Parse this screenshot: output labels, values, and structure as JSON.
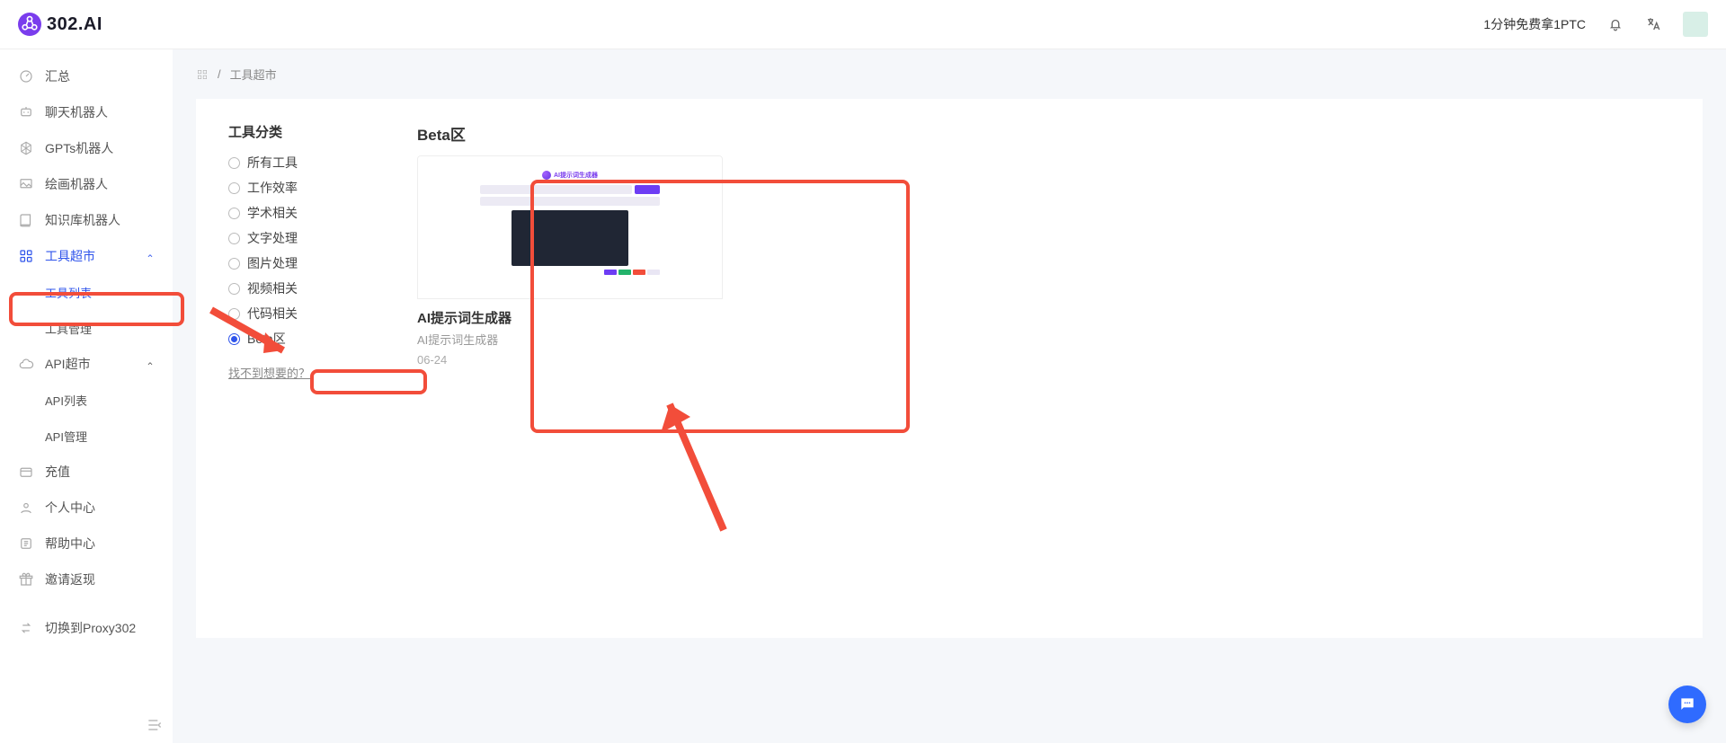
{
  "brand": {
    "name": "302.AI"
  },
  "top": {
    "promo": "1分钟免费拿1PTC"
  },
  "sidebar": {
    "items": [
      {
        "label": "汇总",
        "icon": "dashboard"
      },
      {
        "label": "聊天机器人",
        "icon": "bot"
      },
      {
        "label": "GPTs机器人",
        "icon": "gpt"
      },
      {
        "label": "绘画机器人",
        "icon": "paint"
      },
      {
        "label": "知识库机器人",
        "icon": "book"
      }
    ],
    "tool_market": {
      "label": "工具超市",
      "expanded": true
    },
    "tool_sub": [
      {
        "label": "工具列表",
        "active": true
      },
      {
        "label": "工具管理",
        "active": false
      }
    ],
    "api_market": {
      "label": "API超市",
      "expanded": true
    },
    "api_sub": [
      {
        "label": "API列表"
      },
      {
        "label": "API管理"
      }
    ],
    "rest": [
      {
        "label": "充值",
        "icon": "wallet"
      },
      {
        "label": "个人中心",
        "icon": "person"
      },
      {
        "label": "帮助中心",
        "icon": "help"
      },
      {
        "label": "邀请返现",
        "icon": "gift"
      }
    ],
    "proxy": {
      "label": "切换到Proxy302"
    }
  },
  "breadcrumb": {
    "page": "工具超市"
  },
  "categories": {
    "title": "工具分类",
    "options": [
      {
        "label": "所有工具",
        "checked": false
      },
      {
        "label": "工作效率",
        "checked": false
      },
      {
        "label": "学术相关",
        "checked": false
      },
      {
        "label": "文字处理",
        "checked": false
      },
      {
        "label": "图片处理",
        "checked": false
      },
      {
        "label": "视频相关",
        "checked": false
      },
      {
        "label": "代码相关",
        "checked": false
      },
      {
        "label": "Beta区",
        "checked": true
      }
    ],
    "missing": "找不到想要的？"
  },
  "cards": {
    "section_title": "Beta区",
    "list": [
      {
        "thumb_header": "AI提示词生成器",
        "title": "AI提示词生成器",
        "subtitle": "AI提示词生成器",
        "date": "06-24"
      }
    ]
  }
}
